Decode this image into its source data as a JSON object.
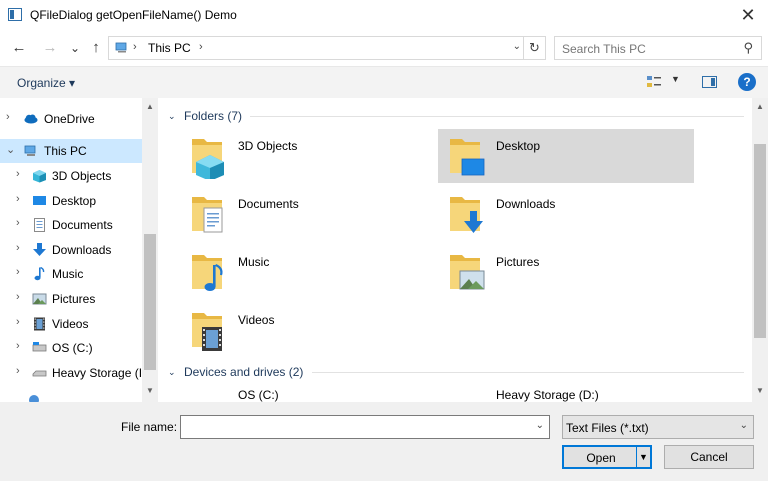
{
  "window": {
    "title": "QFileDialog getOpenFileName() Demo",
    "close_glyph": "✕"
  },
  "nav": {
    "back_glyph": "←",
    "forward_glyph": "→",
    "recent_glyph": "⌄",
    "up_glyph": "↑",
    "address_sep": "›",
    "address_crumb": "This PC",
    "address_dropdown_glyph": "⌄",
    "refresh_glyph": "↻",
    "search_placeholder": "Search This PC",
    "search_glyph": "⚲"
  },
  "toolbar": {
    "organize_label": "Organize ▾",
    "view_dropdown_glyph": "▼",
    "help_glyph": "?"
  },
  "sidebar": {
    "items": [
      {
        "label": "OneDrive",
        "icon": "cloud-icon",
        "selected": false
      },
      {
        "label": "This PC",
        "icon": "computer-icon",
        "selected": true
      },
      {
        "label": "3D Objects",
        "icon": "cube-icon",
        "selected": false
      },
      {
        "label": "Desktop",
        "icon": "desktop-icon",
        "selected": false
      },
      {
        "label": "Documents",
        "icon": "document-icon",
        "selected": false
      },
      {
        "label": "Downloads",
        "icon": "download-icon",
        "selected": false
      },
      {
        "label": "Music",
        "icon": "music-note-icon",
        "selected": false
      },
      {
        "label": "Pictures",
        "icon": "picture-icon",
        "selected": false
      },
      {
        "label": "Videos",
        "icon": "film-icon",
        "selected": false
      },
      {
        "label": "OS (C:)",
        "icon": "drive-icon",
        "selected": false
      },
      {
        "label": "Heavy Storage (I",
        "icon": "drive-icon",
        "selected": false
      }
    ],
    "chevron_right": "›",
    "chevron_down": "⌄"
  },
  "content": {
    "folders_header": "Folders (7)",
    "devices_header": "Devices and drives (2)",
    "folders": [
      {
        "name": "3D Objects",
        "icon": "cube-icon"
      },
      {
        "name": "Desktop",
        "icon": "desktop-icon",
        "selected": true
      },
      {
        "name": "Documents",
        "icon": "document-icon"
      },
      {
        "name": "Downloads",
        "icon": "download-icon"
      },
      {
        "name": "Music",
        "icon": "music-note-icon"
      },
      {
        "name": "Pictures",
        "icon": "picture-icon"
      },
      {
        "name": "Videos",
        "icon": "film-icon"
      }
    ],
    "drives": [
      {
        "name": "OS (C:)"
      },
      {
        "name": "Heavy Storage (D:)"
      }
    ]
  },
  "scroll": {
    "up_glyph": "▲",
    "down_glyph": "▼"
  },
  "footer": {
    "file_name_label": "File name:",
    "file_name_value": "",
    "file_name_dropdown_glyph": "⌄",
    "filter_value": "Text Files (*.txt)",
    "filter_dropdown_glyph": "⌄",
    "open_label": "Open",
    "open_split_glyph": "▼",
    "cancel_label": "Cancel"
  }
}
